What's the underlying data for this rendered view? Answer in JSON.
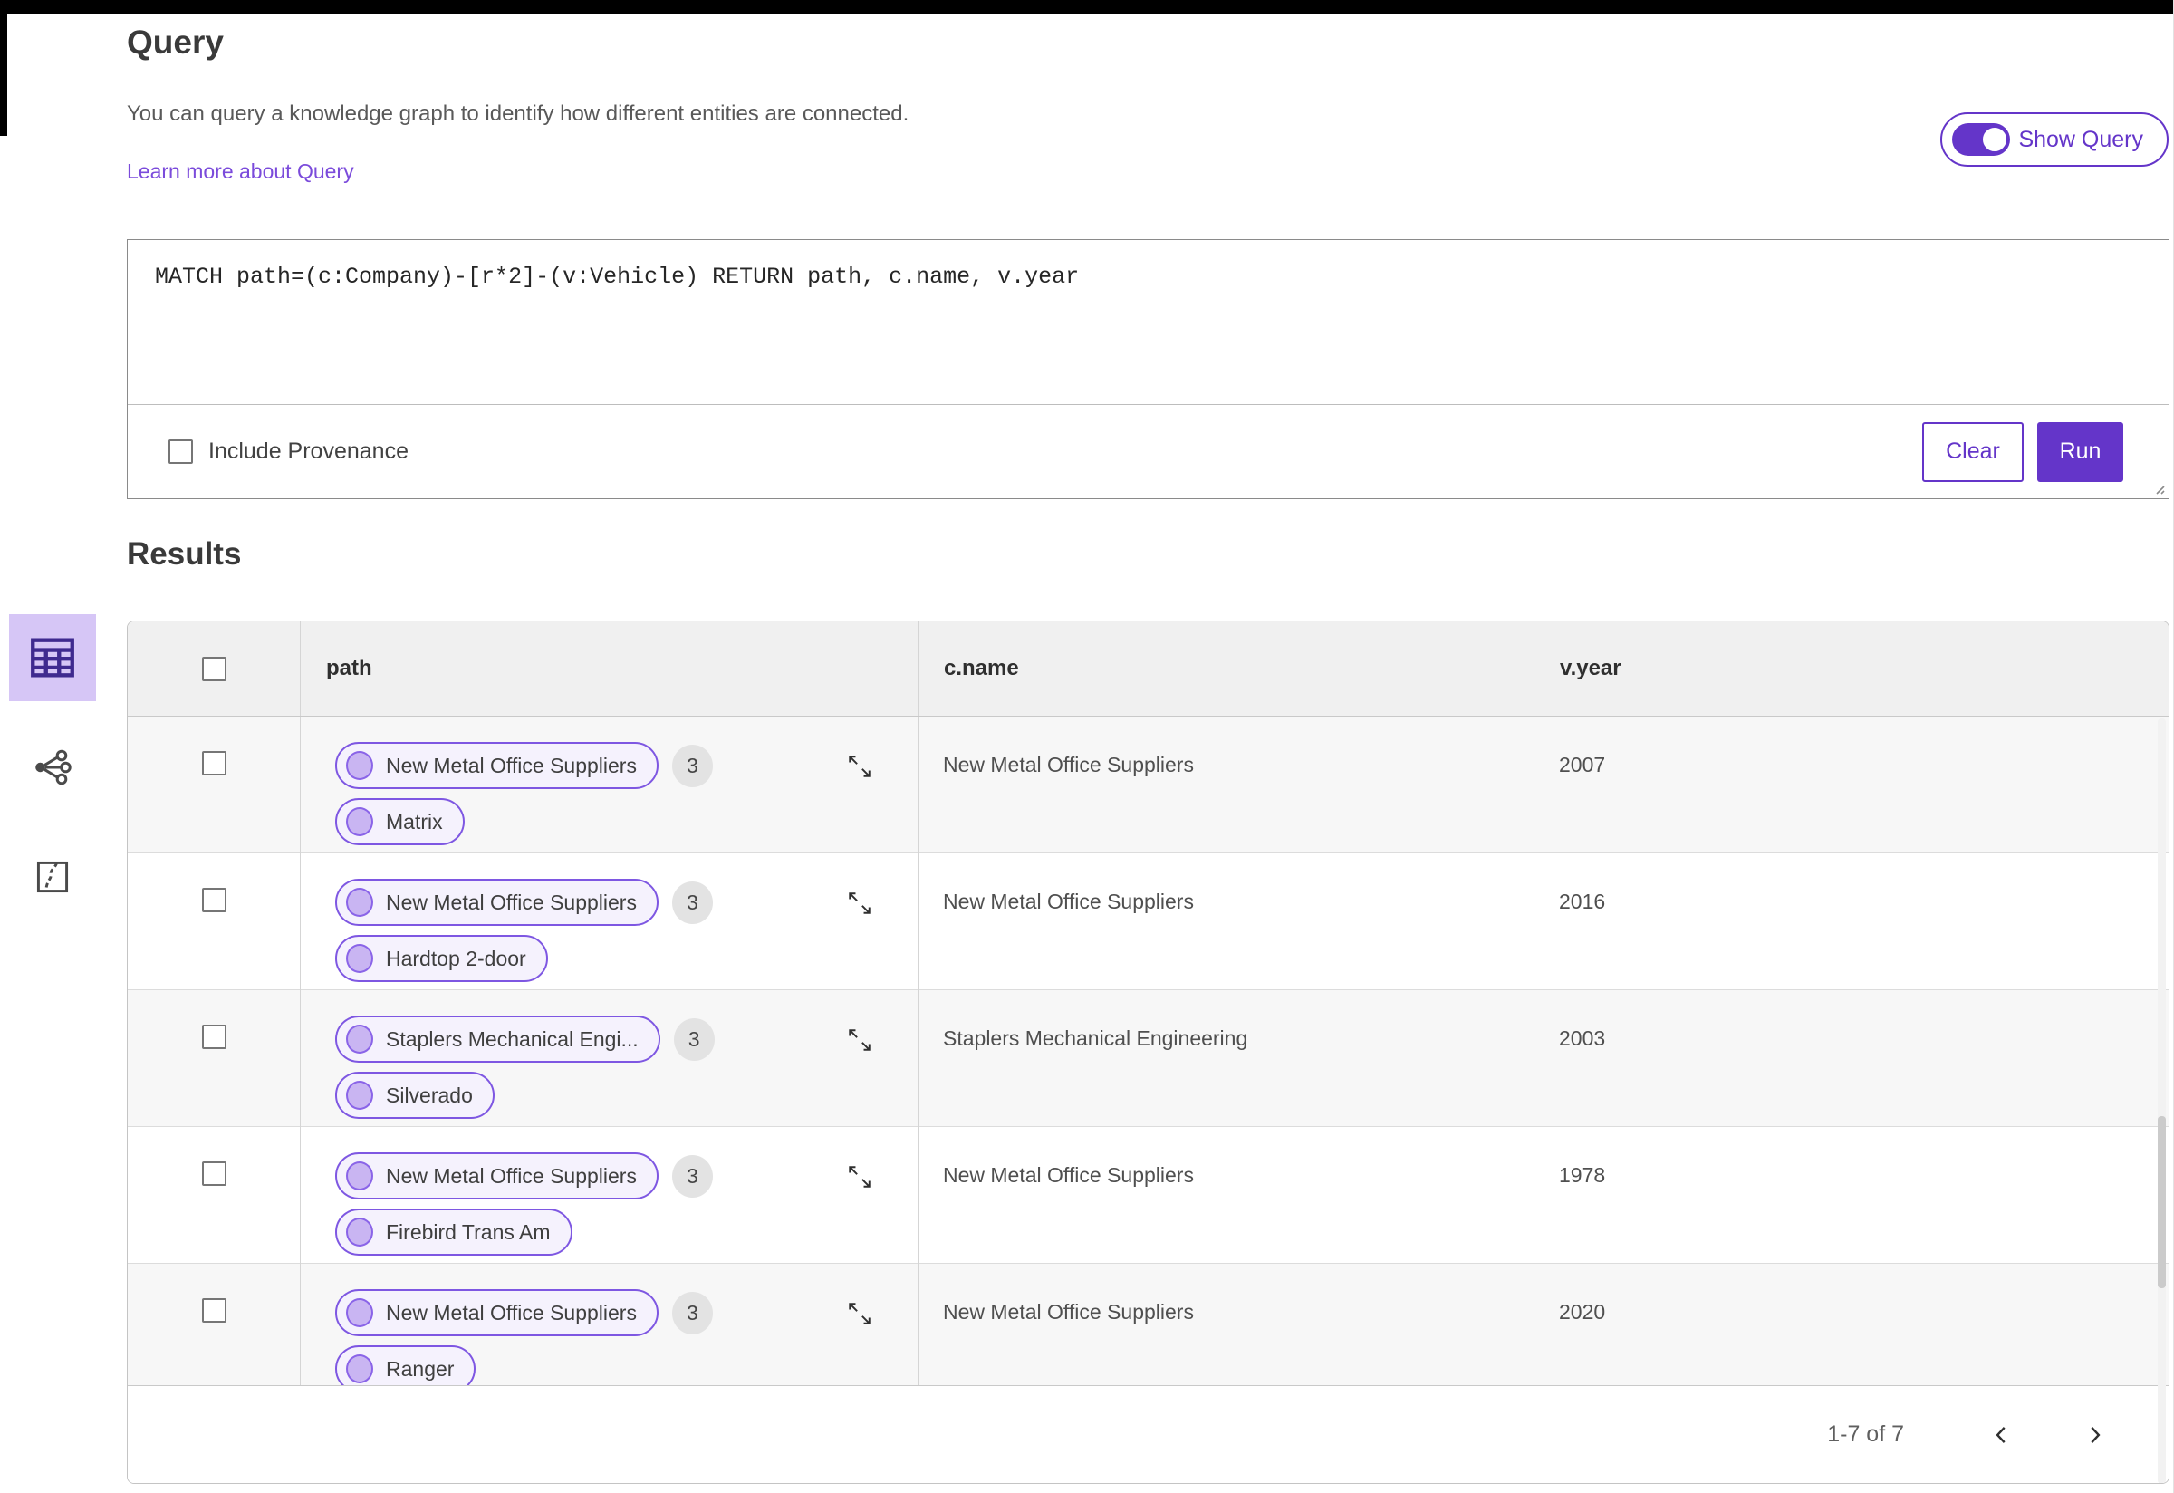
{
  "header": {
    "title": "Query",
    "description": "You can query a knowledge graph to identify how different entities are connected.",
    "learn_more_label": "Learn more about Query",
    "show_query_label": "Show Query",
    "show_query_state": "on"
  },
  "query_panel": {
    "query_text": "MATCH path=(c:Company)-[r*2]-(v:Vehicle) RETURN path, c.name, v.year",
    "include_provenance_label": "Include Provenance",
    "include_provenance_checked": false,
    "clear_label": "Clear",
    "run_label": "Run"
  },
  "results": {
    "title": "Results"
  },
  "view_rail": {
    "items": [
      {
        "id": "table-view",
        "icon": "table-icon",
        "selected": true
      },
      {
        "id": "graph-view",
        "icon": "network-icon",
        "selected": false
      },
      {
        "id": "map-view",
        "icon": "route-map-icon",
        "selected": false
      }
    ]
  },
  "table": {
    "columns": [
      "path",
      "c.name",
      "v.year"
    ],
    "rows": [
      {
        "pills": [
          {
            "label": "New Metal Office Suppliers"
          },
          {
            "label": "Matrix"
          }
        ],
        "count": "3",
        "c_name": "New Metal Office Suppliers",
        "v_year": "2007"
      },
      {
        "pills": [
          {
            "label": "New Metal Office Suppliers"
          },
          {
            "label": "Hardtop 2-door"
          }
        ],
        "count": "3",
        "c_name": "New Metal Office Suppliers",
        "v_year": "2016"
      },
      {
        "pills": [
          {
            "label": "Staplers Mechanical Engi..."
          },
          {
            "label": "Silverado"
          }
        ],
        "count": "3",
        "c_name": "Staplers Mechanical Engineering",
        "v_year": "2003"
      },
      {
        "pills": [
          {
            "label": "New Metal Office Suppliers"
          },
          {
            "label": "Firebird Trans Am"
          }
        ],
        "count": "3",
        "c_name": "New Metal Office Suppliers",
        "v_year": "1978"
      },
      {
        "pills": [
          {
            "label": "New Metal Office Suppliers"
          },
          {
            "label": "Ranger"
          }
        ],
        "count": "3",
        "c_name": "New Metal Office Suppliers",
        "v_year": "2020"
      }
    ],
    "pagination": {
      "range_label": "1-7 of 7"
    }
  },
  "icons": {
    "expand": "expand-diagonal-icon",
    "prev": "chevron-left-icon",
    "next": "chevron-right-icon"
  },
  "colors": {
    "accent_purple": "#6435C9",
    "link_purple": "#7B4BDB",
    "pill_border": "#7E57E2",
    "pill_background": "#F5F2FD",
    "pill_dot_fill": "#C9B5F2",
    "selected_tile": "#D6C6F6",
    "icon_purple": "#3F2A8F",
    "header_row_bg": "#F0F0F0",
    "alt_row_bg": "#F7F7F7",
    "top_bar": "#000000"
  }
}
